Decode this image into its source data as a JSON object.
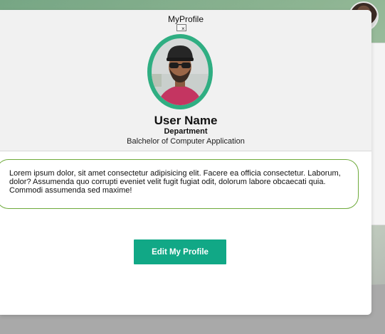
{
  "modal": {
    "title": "MyProfile",
    "close_label": "×"
  },
  "profile": {
    "name": "User Name",
    "department": "Department",
    "degree": "Balchelor of Computer Application",
    "bio": "Lorem ipsum dolor, sit amet consectetur adipisicing elit. Facere ea officia consectetur. Laborum, dolor? Assumenda quo corrupti eveniet velit fugit fugiat odit, dolorum labore obcaecati quia. Commodi assumenda sed maxime!"
  },
  "actions": {
    "edit_label": "Edit My Profile"
  },
  "colors": {
    "accent": "#11a886",
    "avatar_ring": "#2fae82",
    "bio_border": "#6eaa3a"
  },
  "icons": {
    "close": "close-icon",
    "avatar": "profile-photo"
  }
}
